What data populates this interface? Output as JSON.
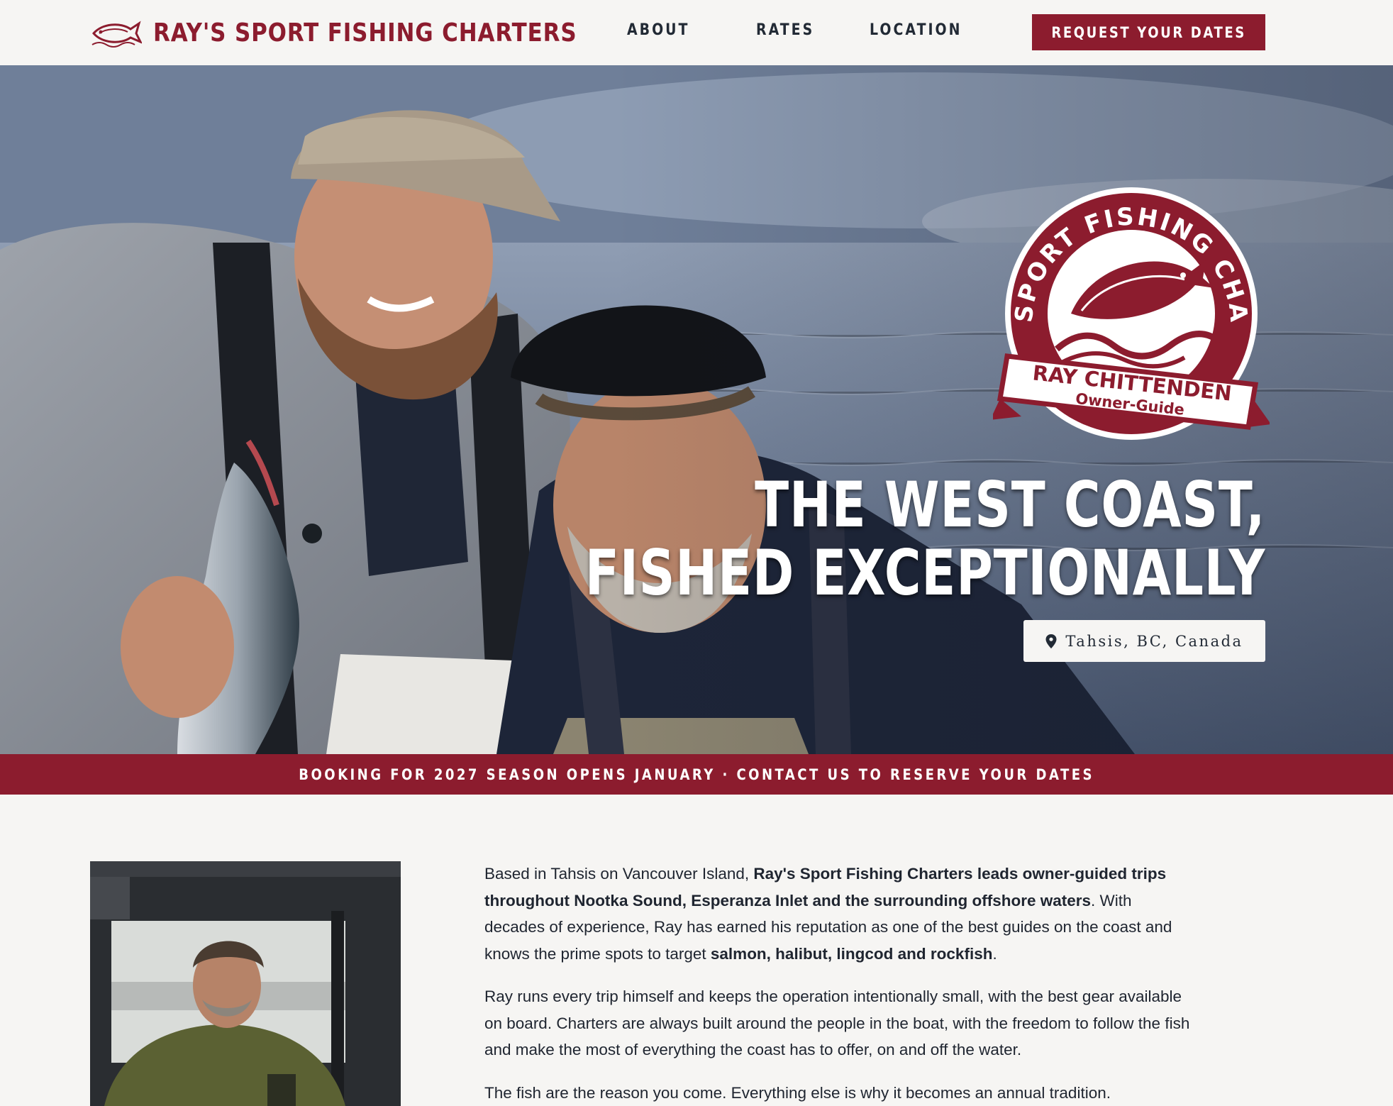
{
  "header": {
    "brand_name": "RAY'S SPORT FISHING CHARTERS",
    "nav": [
      "ABOUT",
      "RATES",
      "LOCATION"
    ],
    "cta_label": "REQUEST YOUR DATES"
  },
  "hero": {
    "badge": {
      "arc_text": "RAY'S SPORT FISHING CHARTERS",
      "banner_name": "RAY CHITTENDEN",
      "banner_role": "Owner-Guide"
    },
    "title_line1": "THE WEST COAST,",
    "title_line2": "FISHED EXCEPTIONALLY",
    "location": "Tahsis, BC, Canada"
  },
  "announcement": "BOOKING FOR 2027 SEASON OPENS JANUARY · CONTACT US TO RESERVE YOUR DATES",
  "about": {
    "p1_a": "Based in Tahsis on Vancouver Island, ",
    "p1_b": "Ray's Sport Fishing Charters leads owner-guided trips throughout Nootka Sound, Esperanza Inlet and the surrounding offshore waters",
    "p1_c": ". With decades of experience, Ray has earned his reputation as one of the best guides on the coast and knows the prime spots to target ",
    "p1_d": "salmon, halibut, lingcod and rockfish",
    "p1_e": ".",
    "p2": "Ray runs every trip himself and keeps the operation intentionally small, with the best gear available on board. Charters are always built around the people in the boat, with the freedom to follow the fish and make the most of everything the coast has to offer, on and off the water.",
    "p3": "The fish are the reason you come. Everything else is why it becomes an annual tradition."
  },
  "icons": {
    "brand_logo": "fish-logo-icon",
    "location": "map-pin-icon"
  },
  "colors": {
    "brand": "#8c1c2e",
    "background": "#f6f5f3",
    "nav_text": "#222a35"
  }
}
